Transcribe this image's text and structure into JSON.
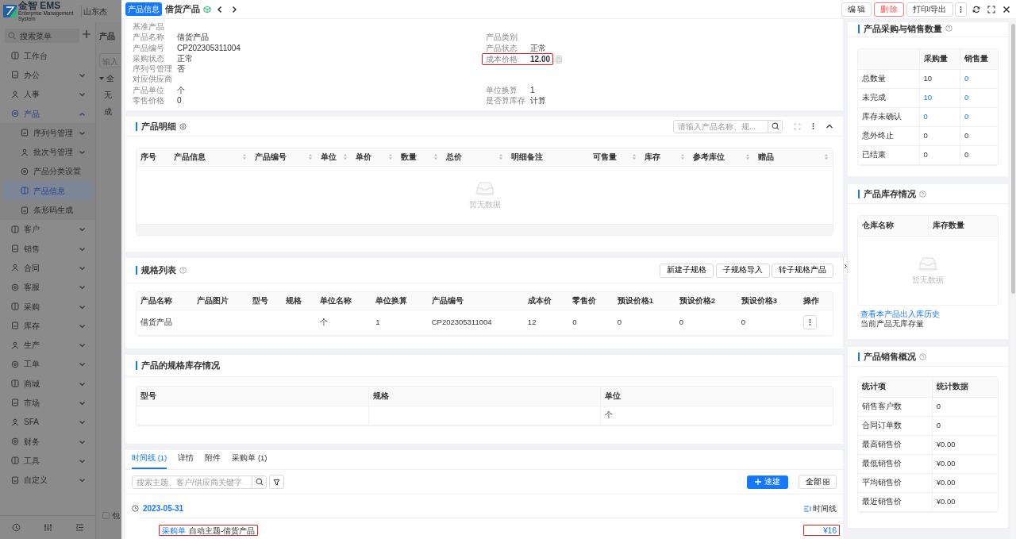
{
  "app": {
    "logo_text": "金智 EMS",
    "logo_subtitle": "Enterprise Management System",
    "company": "山东杰",
    "menu_search_placeholder": "搜索菜单"
  },
  "sidebar": {
    "items": [
      {
        "label": "工作台",
        "selected": false
      },
      {
        "label": "办公",
        "selected": false,
        "expanded": false
      },
      {
        "label": "人事",
        "selected": false,
        "expanded": false
      },
      {
        "label": "产品",
        "selected": false,
        "expanded": true,
        "children": [
          {
            "label": "序列号管理",
            "selected": false,
            "expanded": false
          },
          {
            "label": "批次号管理",
            "selected": false,
            "expanded": false
          },
          {
            "label": "产品分类设置",
            "selected": false
          },
          {
            "label": "产品信息",
            "selected": true
          },
          {
            "label": "条形码生成",
            "selected": false
          }
        ]
      },
      {
        "label": "客户",
        "selected": false,
        "expanded": false
      },
      {
        "label": "销售",
        "selected": false,
        "expanded": false
      },
      {
        "label": "合同",
        "selected": false,
        "expanded": false
      },
      {
        "label": "客服",
        "selected": false,
        "expanded": false
      },
      {
        "label": "采购",
        "selected": false,
        "expanded": false
      },
      {
        "label": "库存",
        "selected": false,
        "expanded": false
      },
      {
        "label": "生产",
        "selected": false,
        "expanded": false
      },
      {
        "label": "工单",
        "selected": false,
        "expanded": false
      },
      {
        "label": "商城",
        "selected": false,
        "expanded": false
      },
      {
        "label": "市场",
        "selected": false,
        "expanded": false
      },
      {
        "label": "SFA",
        "selected": false,
        "expanded": false
      },
      {
        "label": "财务",
        "selected": false,
        "expanded": false
      },
      {
        "label": "工具",
        "selected": false,
        "expanded": false
      },
      {
        "label": "自定义",
        "selected": false,
        "expanded": false
      }
    ]
  },
  "background_page": {
    "title": "产品",
    "filter_placeholder": "输入",
    "tree_root": "全",
    "tree_items": [
      "无",
      "成"
    ],
    "checkbox_label": "包",
    "checked": false
  },
  "drawer": {
    "badge": "产品信息",
    "title": "借货产品",
    "actions": [
      {
        "label": "编 辑",
        "kind": "default"
      },
      {
        "label": "删 除",
        "kind": "danger"
      },
      {
        "label": "打印/导出",
        "kind": "default"
      }
    ]
  },
  "basic_info": {
    "section_label": "基准产品",
    "rows": [
      {
        "left": {
          "label": "产品名称",
          "value": "借货产品",
          "highlighted": false
        },
        "right": {
          "label": "产品类别",
          "highlighted": false
        }
      },
      {
        "left": {
          "label": "产品编号",
          "value": "CP202305311004",
          "highlighted": false
        },
        "right": {
          "label": "产品状态",
          "value": "正常",
          "highlighted": false
        }
      },
      {
        "left": {
          "label": "采购状态",
          "value": "正常",
          "highlighted": false
        },
        "right": {
          "label": "成本价格",
          "value": "12.00",
          "highlighted": true,
          "has_calculator": true
        }
      },
      {
        "left": {
          "label": "序列号管理",
          "value": "否",
          "highlighted": false
        }
      },
      {
        "left": {
          "label": "对应供应商",
          "highlighted": false
        }
      },
      {
        "left": {
          "label": "产品单位",
          "value": "个",
          "highlighted": false
        },
        "right": {
          "label": "单位换算",
          "value": "1",
          "highlighted": false
        }
      },
      {
        "left": {
          "label": "零售价格",
          "value": "0",
          "highlighted": false
        },
        "right": {
          "label": "是否算库存",
          "value": "计算",
          "highlighted": false
        }
      }
    ]
  },
  "detail_table": {
    "title": "产品明细",
    "search_placeholder": "请输入产品名称、规...",
    "columns": [
      {
        "label": "序号",
        "sortable": false
      },
      {
        "label": "产品信息",
        "sortable": true
      },
      {
        "label": "产品编号",
        "sortable": true
      },
      {
        "label": "单位",
        "sortable": true
      },
      {
        "label": "单价",
        "sortable": true
      },
      {
        "label": "数量",
        "sortable": true
      },
      {
        "label": "总价",
        "sortable": true
      },
      {
        "label": "明细备注",
        "sortable": false
      },
      {
        "label": "可售量",
        "sortable": true
      },
      {
        "label": "库存",
        "sortable": true
      },
      {
        "label": "参考库位",
        "sortable": true
      },
      {
        "label": "赠品",
        "sortable": true
      }
    ],
    "empty_text": "暂无数据"
  },
  "spec_list": {
    "title": "规格列表",
    "buttons": [
      "新建子规格",
      "子规格导入",
      "转子规格产品"
    ],
    "columns": [
      "产品名称",
      "产品图片",
      "型号",
      "规格",
      "单位名称",
      "单位换算",
      "产品编号",
      "成本价",
      "零售价",
      "预设价格1",
      "预设价格2",
      "预设价格3",
      "操作"
    ],
    "rows": [
      {
        "cells": [
          "借货产品",
          null,
          null,
          null,
          "个",
          "1",
          "CP202305311004",
          "12",
          "0",
          "0",
          "0",
          "0"
        ],
        "has_menu": true
      }
    ]
  },
  "spec_stock": {
    "title": "产品的规格库存情况",
    "columns": [
      "型号",
      "规格",
      "单位"
    ],
    "rows": [
      [
        null,
        null,
        "个"
      ]
    ]
  },
  "activity": {
    "tabs": [
      {
        "label": "时间线 (1)",
        "selected": true
      },
      {
        "label": "详情",
        "selected": false
      },
      {
        "label": "附件",
        "selected": false
      },
      {
        "label": "采购单 (1)",
        "selected": false
      }
    ],
    "search_placeholder": "搜索主题、客户/供应商关键字",
    "create_button": "速建",
    "filter_button": "全部",
    "date": "2023-05-31",
    "view_label": "时间线",
    "entries": [
      {
        "type_label": "采购单",
        "subject": "自动主题-借货产品",
        "amount": "¥16",
        "highlighted": true
      }
    ]
  },
  "purchase_sales": {
    "title": "产品采购与销售数量",
    "columns": [
      "采购量",
      "销售量"
    ],
    "rows": [
      {
        "label": "总数量",
        "cells": [
          {
            "text": "10",
            "link": false
          },
          {
            "text": "0",
            "link": true
          }
        ]
      },
      {
        "label": "未完成",
        "cells": [
          {
            "text": "10",
            "link": true
          },
          {
            "text": "0",
            "link": true
          }
        ]
      },
      {
        "label": "库存未确认",
        "cells": [
          {
            "text": "0",
            "link": true
          },
          {
            "text": "0",
            "link": true
          }
        ]
      },
      {
        "label": "意外终止",
        "cells": [
          {
            "text": "0",
            "link": false
          },
          {
            "text": "0",
            "link": false
          }
        ]
      },
      {
        "label": "已结束",
        "cells": [
          {
            "text": "0",
            "link": false
          },
          {
            "text": "0",
            "link": false
          }
        ]
      }
    ]
  },
  "stock": {
    "title": "产品库存情况",
    "columns": [
      "仓库名称",
      "库存数量"
    ],
    "empty_text": "暂无数据",
    "history_link": "查看本产品出入库历史",
    "note": "当前产品无库存量"
  },
  "sales_overview": {
    "title": "产品销售概况",
    "columns": [
      "统计项",
      "统计数据"
    ],
    "rows": [
      [
        "销售客户数",
        "0"
      ],
      [
        "合同订单数",
        "0"
      ],
      [
        "最高销售价",
        "¥0.00"
      ],
      [
        "最低销售价",
        "¥0.00"
      ],
      [
        "平均销售价",
        "¥0.00"
      ],
      [
        "最近销售价",
        "¥0.00"
      ]
    ]
  }
}
